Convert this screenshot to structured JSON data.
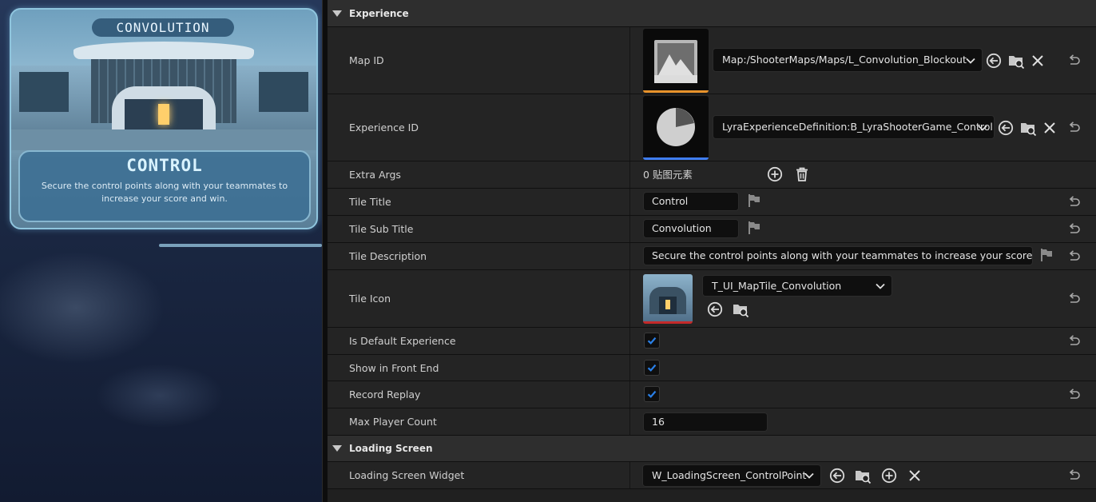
{
  "preview": {
    "tile_badge": "CONVOLUTION",
    "tile_title": "CONTROL",
    "tile_description": "Secure the control points along with your teammates to increase your score and win."
  },
  "details": {
    "categories": {
      "experience": "Experience",
      "loading_screen": "Loading Screen"
    },
    "map_id": {
      "label": "Map ID",
      "value": "Map:/ShooterMaps/Maps/L_Convolution_Blockout"
    },
    "experience_id": {
      "label": "Experience ID",
      "value": "LyraExperienceDefinition:B_LyraShooterGame_ControlPoints"
    },
    "extra_args": {
      "label": "Extra Args",
      "value": "0 贴图元素"
    },
    "tile_title": {
      "label": "Tile Title",
      "value": "Control"
    },
    "tile_sub_title": {
      "label": "Tile Sub Title",
      "value": "Convolution"
    },
    "tile_description": {
      "label": "Tile Description",
      "value": "Secure the control points along with your teammates to increase your score and win."
    },
    "tile_icon": {
      "label": "Tile Icon",
      "value": "T_UI_MapTile_Convolution"
    },
    "is_default_experience": {
      "label": "Is Default Experience",
      "checked": true
    },
    "show_in_front_end": {
      "label": "Show in Front End",
      "checked": true
    },
    "record_replay": {
      "label": "Record Replay",
      "checked": true
    },
    "max_player_count": {
      "label": "Max Player Count",
      "value": "16"
    },
    "loading_screen_widget": {
      "label": "Loading Screen Widget",
      "value": "W_LoadingScreen_ControlPoint"
    }
  },
  "colors": {
    "checkbox_accent": "#1f72d8",
    "map_thumb_underline": "#e8922a",
    "experience_thumb_underline": "#3f7df0",
    "tile_icon_underline": "#c42a2a"
  }
}
